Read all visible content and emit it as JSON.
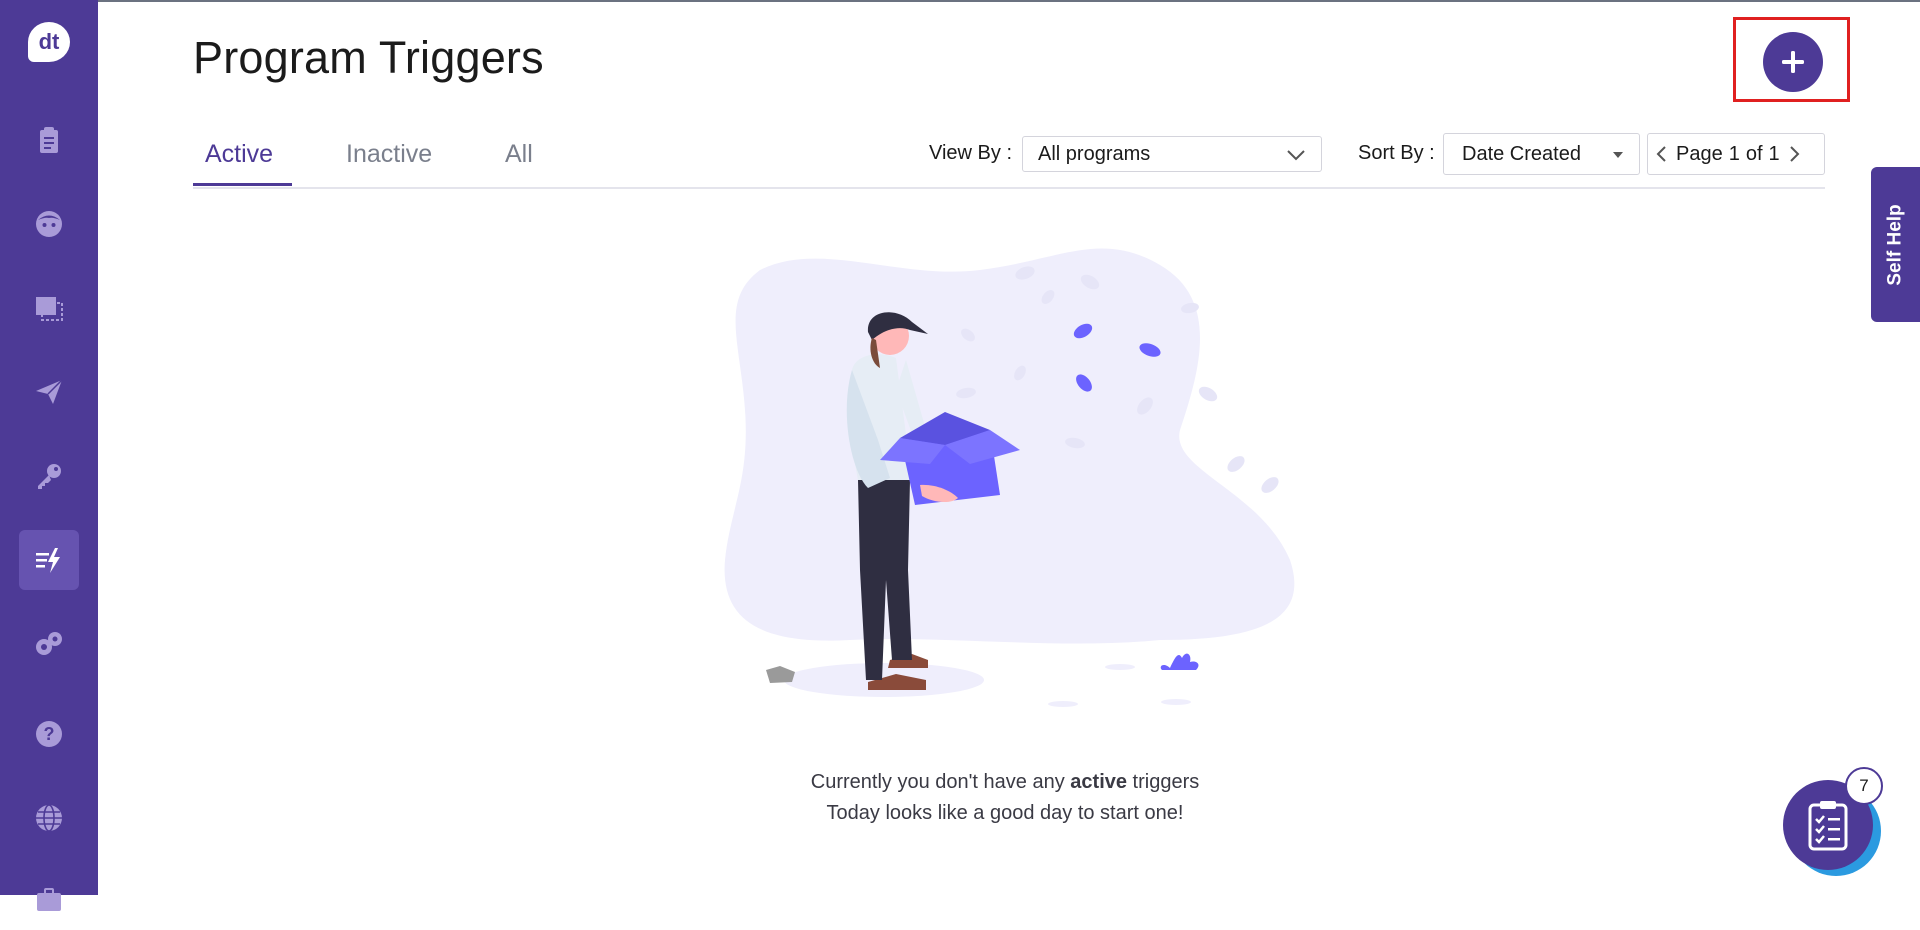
{
  "app": {
    "logo_text": "dt"
  },
  "header": {
    "title": "Program Triggers"
  },
  "tabs": [
    {
      "label": "Active",
      "selected": true
    },
    {
      "label": "Inactive",
      "selected": false
    },
    {
      "label": "All",
      "selected": false
    }
  ],
  "filters": {
    "view_by_label": "View By :",
    "view_by_value": "All programs",
    "sort_by_label": "Sort By :",
    "sort_by_value": "Date Created"
  },
  "pagination": {
    "page_label": "Page",
    "current": "1",
    "of_label": "of",
    "total": "1"
  },
  "empty_state": {
    "line1_prefix": "Currently you don't have any ",
    "line1_bold": "active",
    "line1_suffix": " triggers",
    "line2": "Today looks like a good day to  start one!"
  },
  "self_help": {
    "label": "Self Help"
  },
  "checklist": {
    "count": "7"
  },
  "sidebar": {
    "items": [
      {
        "icon": "clipboard-icon"
      },
      {
        "icon": "face-icon"
      },
      {
        "icon": "select-screen-icon"
      },
      {
        "icon": "paper-plane-icon"
      },
      {
        "icon": "key-icon"
      },
      {
        "icon": "triggers-icon",
        "active": true
      },
      {
        "icon": "puzzle-icon"
      },
      {
        "icon": "help-icon"
      },
      {
        "icon": "globe-icon"
      },
      {
        "icon": "briefcase-icon"
      }
    ]
  },
  "colors": {
    "brand": "#4d3a96",
    "highlight_frame": "#e02020",
    "accent_blue": "#2b9ae0"
  }
}
